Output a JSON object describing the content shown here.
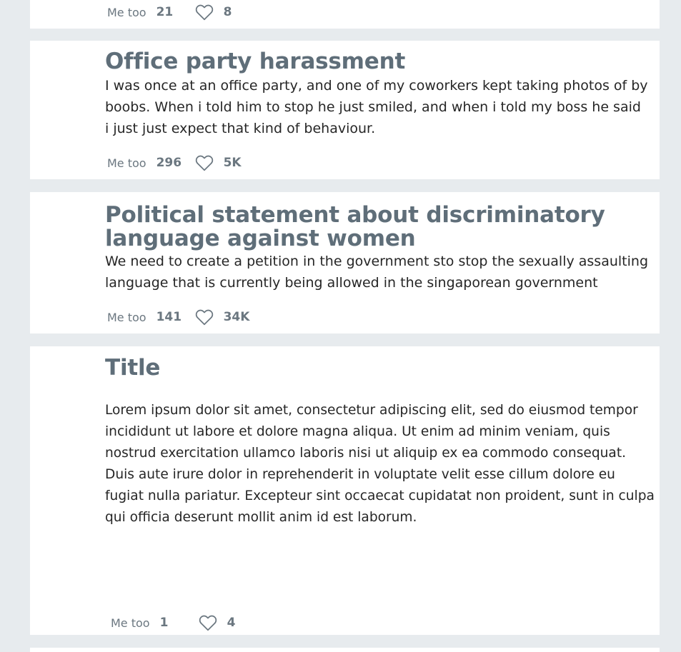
{
  "posts": [
    {
      "title": "",
      "body": "",
      "metoo_label": "Me too",
      "metoo_count": "21",
      "likes": "8",
      "icon": "heart-icon"
    },
    {
      "title": "Office party harassment",
      "body": "I was once at an office party, and one of my coworkers kept taking photos of by boobs. When i told him to stop he just smiled, and when i told my boss he said i just just expect that kind of behaviour.",
      "metoo_label": "Me too",
      "metoo_count": "296",
      "likes": "5K",
      "icon": "heart-icon"
    },
    {
      "title": "Political statement about discriminatory language against women",
      "body": "We need to create a petition in the government sto stop the sexually assaulting language that is currently being allowed in the singaporean government",
      "metoo_label": "Me too",
      "metoo_count": "141",
      "likes": "34K",
      "icon": "heart-icon"
    },
    {
      "title": "Title",
      "body": "Lorem ipsum dolor sit amet, consectetur adipiscing elit, sed do eiusmod tempor incididunt ut labore et dolore magna aliqua. Ut enim ad minim veniam, quis nostrud exercitation ullamco laboris nisi ut aliquip ex ea commodo consequat. Duis aute irure dolor in reprehenderit in voluptate velit esse cillum dolore eu fugiat nulla pariatur. Excepteur sint occaecat cupidatat non proident, sunt in culpa qui officia deserunt mollit anim id est laborum.",
      "metoo_label": "Me too",
      "metoo_count": "1",
      "likes": "4",
      "icon": "heart-icon"
    }
  ],
  "colors": {
    "background": "#e7ebee",
    "card": "#ffffff",
    "title": "#5f6e79",
    "body_text": "#262626",
    "meta_text": "#6b7780"
  }
}
